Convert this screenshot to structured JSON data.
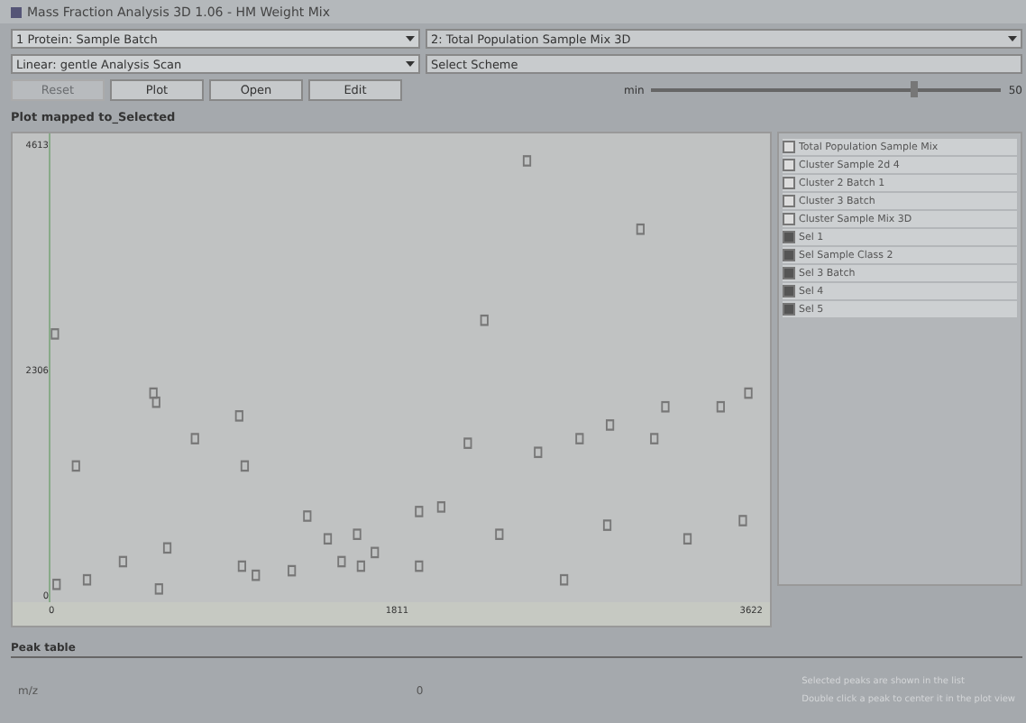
{
  "window": {
    "title": "Mass Fraction Analysis 3D 1.06 - HM Weight Mix"
  },
  "selectors": [
    {
      "value": "1 Protein: Sample Batch"
    },
    {
      "value": "Linear: gentle Analysis Scan"
    }
  ],
  "side_fields": [
    {
      "kind": "dropdown",
      "value": "2: Total Population Sample Mix 3D"
    },
    {
      "kind": "text",
      "value": "Select Scheme"
    }
  ],
  "buttons": [
    {
      "label": "Reset",
      "disabled": true
    },
    {
      "label": "Plot",
      "disabled": false
    },
    {
      "label": "Open",
      "disabled": false
    },
    {
      "label": "Edit",
      "disabled": false
    }
  ],
  "slider": {
    "label": "min",
    "reading": "50",
    "level": 0.75
  },
  "plot": {
    "title": "Plot mapped to_Selected",
    "y_ticks": [
      "4613",
      "2306",
      "0"
    ],
    "x_ticks": [
      "0",
      "1811",
      "3622"
    ]
  },
  "legend": [
    {
      "label": "Total Population Sample Mix",
      "checked": false
    },
    {
      "label": "Cluster Sample 2d 4",
      "checked": false
    },
    {
      "label": "Cluster 2 Batch 1",
      "checked": false
    },
    {
      "label": "Cluster 3 Batch",
      "checked": false
    },
    {
      "label": "Cluster Sample Mix 3D",
      "checked": false
    },
    {
      "label": "Sel 1",
      "checked": true
    },
    {
      "label": "Sel Sample Class 2",
      "checked": true
    },
    {
      "label": "Sel 3 Batch",
      "checked": true
    },
    {
      "label": "Sel 4",
      "checked": true
    },
    {
      "label": "Sel 5",
      "checked": true
    }
  ],
  "table": {
    "title": "Peak table",
    "cells": [
      "m/z",
      "0"
    ],
    "notes": [
      "Selected peaks are shown in the list",
      "Double click a peak to center it in the plot view"
    ]
  }
}
